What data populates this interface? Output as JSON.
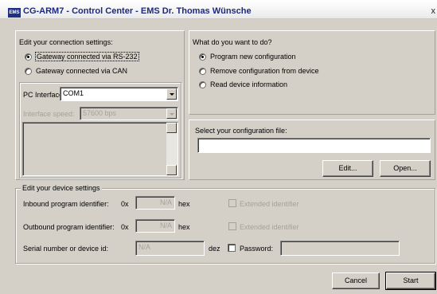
{
  "window": {
    "icon_text": "EMS",
    "title": "CG-ARM7 - Control Center - EMS Dr. Thomas Wünsche",
    "close": "x"
  },
  "connection": {
    "heading": "Edit your connection settings:",
    "options": [
      {
        "label": "Gateway connected via RS-232",
        "selected": true
      },
      {
        "label": "Gateway connected via CAN",
        "selected": false
      }
    ],
    "pc_interface_label": "PC Interface:",
    "pc_interface_value": "COM1",
    "speed_label": "Interface speed:",
    "speed_value": "57600 bps"
  },
  "action": {
    "heading": "What do you want to do?",
    "options": [
      {
        "label": "Program new configuration",
        "selected": true
      },
      {
        "label": "Remove configuration from device",
        "selected": false
      },
      {
        "label": "Read device information",
        "selected": false
      }
    ]
  },
  "config_file": {
    "label": "Select your configuration file:",
    "value": "",
    "edit_label": "Edit...",
    "open_label": "Open..."
  },
  "device": {
    "heading": "Edit your device settings",
    "inbound_label": "Inbound program identifier:",
    "outbound_label": "Outbound program identifier:",
    "prefix": "0x",
    "inbound_value": "N/A",
    "outbound_value": "N/A",
    "hex_unit": "hex",
    "extended_label": "Extended identifier",
    "serial_label": "Serial number or device id:",
    "serial_value": "N/A",
    "dez_unit": "dez",
    "password_label": "Password:",
    "password_value": ""
  },
  "footer": {
    "cancel_label": "Cancel",
    "start_label": "Start"
  }
}
